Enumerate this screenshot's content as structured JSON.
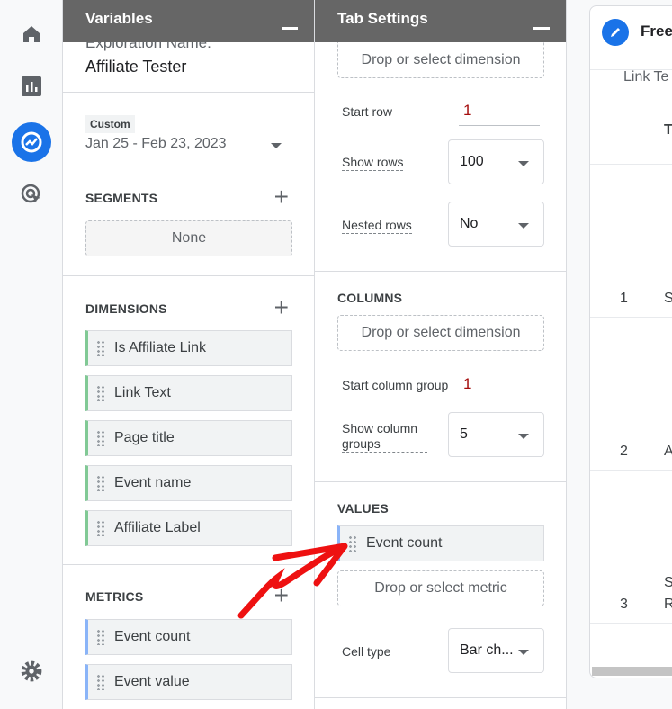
{
  "rail": {
    "icons": [
      "home-icon",
      "reports-icon",
      "explore-icon",
      "advertising-icon",
      "settings-icon"
    ],
    "accent": "#1a73e8"
  },
  "variables": {
    "title": "Variables",
    "exploration_label": "Exploration Name:",
    "exploration_name": "Affiliate Tester",
    "date_badge": "Custom",
    "date_range": "Jan 25 - Feb 23, 2023",
    "segments_title": "SEGMENTS",
    "segments_value": "None",
    "dimensions_title": "DIMENSIONS",
    "dimensions": [
      "Is Affiliate Link",
      "Link Text",
      "Page title",
      "Event name",
      "Affiliate Label"
    ],
    "metrics_title": "METRICS",
    "metrics": [
      "Event count",
      "Event value"
    ]
  },
  "tab_settings": {
    "title": "Tab Settings",
    "rows_drop": "Drop or select dimension",
    "start_row_label": "Start row",
    "start_row": "1",
    "show_rows_label": "Show rows",
    "show_rows": "100",
    "nested_rows_label": "Nested rows",
    "nested_rows": "No",
    "columns_title": "COLUMNS",
    "columns_drop": "Drop or select dimension",
    "start_col_label": "Start column group",
    "start_col": "1",
    "show_col_label": "Show column groups",
    "show_col": "5",
    "values_title": "VALUES",
    "value_chip": "Event count",
    "values_drop": "Drop or select metric",
    "cell_type_label": "Cell type",
    "cell_type": "Bar ch..."
  },
  "report": {
    "tab_name": "Free",
    "subheader": "Link Te",
    "col_header": "T",
    "rows": [
      {
        "n": "1",
        "text": "S"
      },
      {
        "n": "2",
        "text": "A"
      },
      {
        "n": "3",
        "text": "S",
        "text2": "R"
      }
    ]
  }
}
